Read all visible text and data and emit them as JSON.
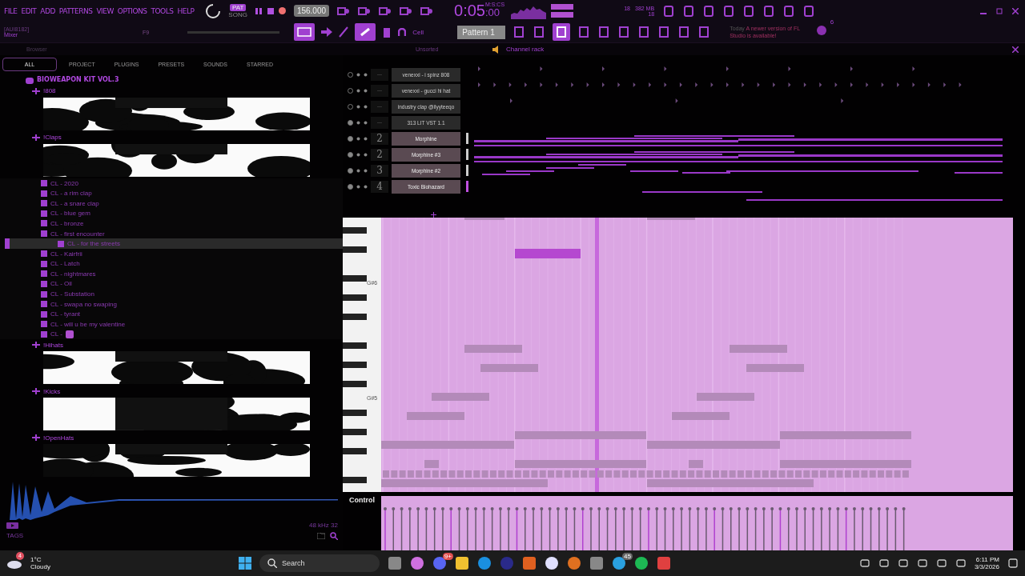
{
  "menu": [
    "FILE",
    "EDIT",
    "ADD",
    "PATTERNS",
    "VIEW",
    "OPTIONS",
    "TOOLS",
    "HELP"
  ],
  "transport": {
    "modes": [
      {
        "label": "PAT",
        "selected": true
      },
      {
        "label": "SONG",
        "selected": false
      }
    ],
    "recording": true,
    "tempo": "156.000",
    "time": "0:05",
    "time_cs": ":00",
    "time_unit": "M:S:CS"
  },
  "monitor": {
    "cpu": "18",
    "memory": "382 MB",
    "polyphony": "18"
  },
  "hint": {
    "title": "[AUI8182]",
    "text": "Mixer",
    "shortcut": "F9"
  },
  "snap": "Cell",
  "pattern": "Pattern 1",
  "news": {
    "label": "Today",
    "message": "A newer version of FL Studio is available!",
    "count": "6"
  },
  "browser": {
    "title": "Browser",
    "tabs": [
      {
        "label": "ALL",
        "selected": true
      },
      {
        "label": "PROJECT",
        "selected": false
      },
      {
        "label": "PLUGINS",
        "selected": false
      },
      {
        "label": "PRESETS",
        "selected": false
      },
      {
        "label": "SOUNDS",
        "selected": false
      },
      {
        "label": "STARRED",
        "selected": false
      }
    ],
    "tree": {
      "name": "BIOWEAPON KIT VOL.3",
      "children": [
        {
          "name": "!808"
        },
        {
          "name": "!Claps",
          "children": [
            {
              "name": "CL - 2020",
              "selected": false
            },
            {
              "name": "CL - a rim clap",
              "selected": false
            },
            {
              "name": "CL - a snare clap",
              "selected": false
            },
            {
              "name": "CL - blue gem",
              "selected": false
            },
            {
              "name": "CL - bronze",
              "selected": false
            },
            {
              "name": "CL - first encounter",
              "selected": false
            },
            {
              "name": "CL - for the streets",
              "selected": true
            },
            {
              "name": "CL - Kairfrii",
              "selected": false
            },
            {
              "name": "CL - Latch",
              "selected": false
            },
            {
              "name": "CL - nightmares",
              "selected": false
            },
            {
              "name": "CL - Oil",
              "selected": false
            },
            {
              "name": "CL - Substation",
              "selected": false
            },
            {
              "name": "CL - swapa no swaping",
              "selected": false
            },
            {
              "name": "CL - tyrant",
              "selected": false
            },
            {
              "name": "CL - will u be my valentine",
              "selected": false
            },
            {
              "name": "CL -",
              "selected": false
            }
          ]
        },
        {
          "name": "!Hihats"
        },
        {
          "name": "!Kicks"
        },
        {
          "name": "!OpenHats"
        }
      ]
    },
    "sample_info": "48 kHz 32",
    "tags": "TAGS"
  },
  "channel_rack": {
    "filter": "Unsorted",
    "title": "Channel rack",
    "channels": [
      {
        "number": "---",
        "name": "venexxi - i spinz 808",
        "on": false,
        "kind": "steps"
      },
      {
        "number": "---",
        "name": "venexxi - gucci hi hat",
        "on": false,
        "kind": "steps"
      },
      {
        "number": "---",
        "name": "industry clap @ilyyteeqo",
        "on": false,
        "kind": "steps"
      },
      {
        "number": "---",
        "name": "313 LIT VST 1.1",
        "on": true,
        "kind": "empty"
      },
      {
        "number": "2",
        "name": "Morphine",
        "on": true,
        "kind": "notes"
      },
      {
        "number": "2",
        "name": "Morphine #3",
        "on": true,
        "kind": "notes"
      },
      {
        "number": "3",
        "name": "Morphine #2",
        "on": true,
        "kind": "notes"
      },
      {
        "number": "4",
        "name": "Toxic Biohazard",
        "on": true,
        "kind": "notes"
      }
    ]
  },
  "piano_roll": {
    "key_labels": [
      "G#6",
      "G#5"
    ],
    "control_label": "Control"
  },
  "taskbar": {
    "weather": {
      "temperature": "1°C",
      "condition": "Cloudy",
      "badge": "4"
    },
    "search": {
      "placeholder": "Search"
    },
    "badges": [
      "9+",
      "45"
    ],
    "time": "6:11 PM",
    "date": "3/3/2026"
  }
}
